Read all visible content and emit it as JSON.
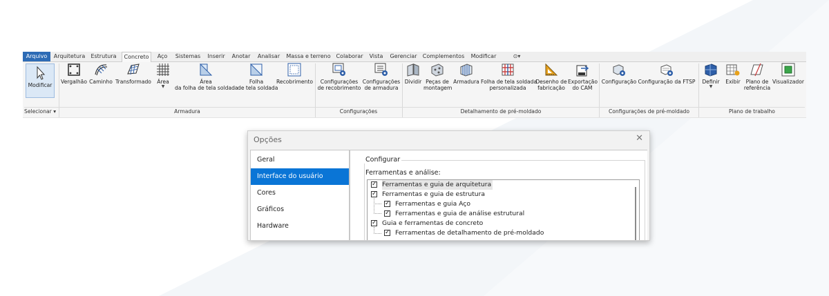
{
  "ribbon": {
    "tabs": [
      {
        "label": "Arquivo",
        "state": "file"
      },
      {
        "label": "Arquitetura",
        "state": ""
      },
      {
        "label": "Estrutura",
        "state": ""
      },
      {
        "label": "Concreto",
        "state": "active"
      },
      {
        "label": "Aço",
        "state": ""
      },
      {
        "label": "Sistemas",
        "state": ""
      },
      {
        "label": "Inserir",
        "state": ""
      },
      {
        "label": "Anotar",
        "state": ""
      },
      {
        "label": "Analisar",
        "state": ""
      },
      {
        "label": "Massa e terreno",
        "state": ""
      },
      {
        "label": "Colaborar",
        "state": ""
      },
      {
        "label": "Vista",
        "state": ""
      },
      {
        "label": "Gerenciar",
        "state": ""
      },
      {
        "label": "Complementos",
        "state": ""
      },
      {
        "label": "Modificar",
        "state": ""
      },
      {
        "label": "⊙▾",
        "state": "more"
      }
    ],
    "tools": {
      "modificar": "Modificar",
      "vergalhao": "Vergalhão",
      "caminho": "Caminho",
      "transformado": "Transformado",
      "area": "Área",
      "area_folha_1": "Área",
      "area_folha_2": "da folha de tela soldada",
      "folha_1": "Folha",
      "folha_2": "de tela soldada",
      "recobrimento": "Recobrimento",
      "config_recob_1": "Configurações",
      "config_recob_2": "de recobrimento",
      "config_arm_1": "Configurações",
      "config_arm_2": "de armadura",
      "dividir": "Dividir",
      "pecas_1": "Peças de",
      "pecas_2": "montagem",
      "armadura": "Armadura",
      "folha_pers_1": "Folha de tela soldada",
      "folha_pers_2": "personalizada",
      "desenho_1": "Desenho de",
      "desenho_2": "fabricação",
      "exportacao_1": "Exportação",
      "exportacao_2": "do CAM",
      "configuracao": "Configuração",
      "config_ftsp": "Configuração da FTSP",
      "definir": "Definir",
      "exibir": "Exibir",
      "plano_ref_1": "Plano de",
      "plano_ref_2": "referência",
      "visualizador": "Visualizador"
    },
    "groups": {
      "selecionar": "Selecionar ▾",
      "armadura": "Armadura",
      "configuracoes": "Configurações",
      "detalhamento": "Detalhamento de pré-moldado",
      "config_pre": "Configurações de pré-moldado",
      "plano": "Plano de trabalho"
    },
    "colors": {
      "file_tab": "#2d6bb5",
      "icon_blue": "#2d5ea8",
      "icon_orange": "#e8a21c",
      "icon_green": "#3aa64a"
    }
  },
  "dialog": {
    "title": "Opções",
    "close": "✕",
    "nav": [
      {
        "label": "Geral",
        "selected": false
      },
      {
        "label": "Interface do usuário",
        "selected": true
      },
      {
        "label": "Cores",
        "selected": false
      },
      {
        "label": "Gráficos",
        "selected": false
      },
      {
        "label": "Hardware",
        "selected": false
      }
    ],
    "group_title": "Configurar",
    "tools_label": "Ferramentas e análise:",
    "tree": [
      {
        "label": "Ferramentas e guia de arquitetura",
        "checked": true,
        "level": 0
      },
      {
        "label": "Ferramentas e guia de estrutura",
        "checked": true,
        "level": 0
      },
      {
        "label": "Ferramentas e guia Aço",
        "checked": true,
        "level": 1
      },
      {
        "label": "Ferramentas e guia de análise estrutural",
        "checked": true,
        "level": 1
      },
      {
        "label": "Guia e ferramentas de concreto",
        "checked": true,
        "level": 0
      },
      {
        "label": "Ferramentas de detalhamento de pré-moldado",
        "checked": true,
        "level": 1
      }
    ],
    "check_glyph": "✓",
    "selected_color": "#0a75d6"
  }
}
